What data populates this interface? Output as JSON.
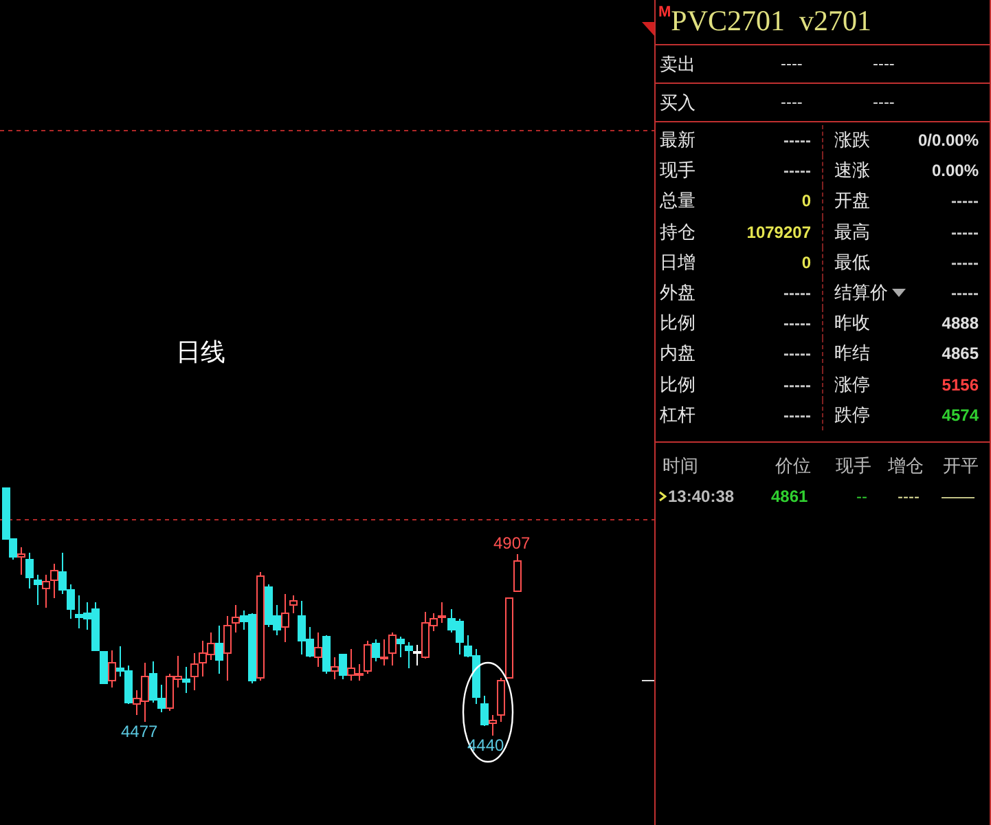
{
  "chart": {
    "title": "日线",
    "high_label": "4907",
    "low_labels": [
      "4477",
      "4440"
    ]
  },
  "quote": {
    "badge": "M",
    "title": "PVC2701  v2701",
    "book": [
      {
        "label": "卖出",
        "values": [
          "----",
          "----"
        ]
      },
      {
        "label": "买入",
        "values": [
          "----",
          "----"
        ]
      }
    ],
    "stats": [
      [
        {
          "label": "最新",
          "value": "-----",
          "color": "#c8c8c8"
        },
        {
          "label": "涨跌",
          "value": "0/0.00%",
          "color": "#e0e0e0"
        }
      ],
      [
        {
          "label": "现手",
          "value": "-----",
          "color": "#c8c8c8"
        },
        {
          "label": "速涨",
          "value": "0.00%",
          "color": "#e0e0e0"
        }
      ],
      [
        {
          "label": "总量",
          "value": "0",
          "color": "#e6e650"
        },
        {
          "label": "开盘",
          "value": "-----",
          "color": "#c8c8c8"
        }
      ],
      [
        {
          "label": "持仓",
          "value": "1079207",
          "color": "#e6e650"
        },
        {
          "label": "最高",
          "value": "-----",
          "color": "#c8c8c8"
        }
      ],
      [
        {
          "label": "日增",
          "value": "0",
          "color": "#e6e650"
        },
        {
          "label": "最低",
          "value": "-----",
          "color": "#c8c8c8"
        }
      ],
      [
        {
          "label": "外盘",
          "value": "-----",
          "color": "#c8c8c8"
        },
        {
          "label": "结算价",
          "value": "-----",
          "color": "#c8c8c8",
          "dropdown": true
        }
      ],
      [
        {
          "label": "比例",
          "value": "-----",
          "color": "#c8c8c8"
        },
        {
          "label": "昨收",
          "value": "4888",
          "color": "#e0e0e0"
        }
      ],
      [
        {
          "label": "内盘",
          "value": "-----",
          "color": "#c8c8c8"
        },
        {
          "label": "昨结",
          "value": "4865",
          "color": "#e0e0e0"
        }
      ],
      [
        {
          "label": "比例",
          "value": "-----",
          "color": "#c8c8c8"
        },
        {
          "label": "涨停",
          "value": "5156",
          "color": "#ff4040"
        }
      ],
      [
        {
          "label": "杠杆",
          "value": "-----",
          "color": "#c8c8c8"
        },
        {
          "label": "跌停",
          "value": "4574",
          "color": "#30d030"
        }
      ]
    ]
  },
  "trades": {
    "columns": [
      "时间",
      "价位",
      "现手",
      "增仓",
      "开平"
    ],
    "rows": [
      {
        "time": "13:40:38",
        "price": "4861",
        "hand": "--",
        "change": "----",
        "type": "——"
      }
    ]
  }
}
